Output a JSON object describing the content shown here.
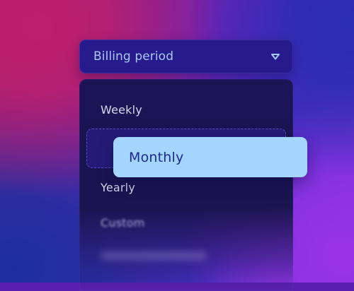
{
  "select": {
    "label": "Billing period",
    "icon": "chevron-down-icon"
  },
  "menu": {
    "items": [
      {
        "label": "Weekly"
      },
      {
        "label": "Monthly"
      },
      {
        "label": "Yearly"
      },
      {
        "label": "Custom"
      }
    ]
  },
  "dragging": {
    "label": "Monthly"
  },
  "colors": {
    "select_bg": "#261a8c",
    "menu_bg": "#1c1455",
    "drag_card_bg": "#a4d5ff",
    "drag_text": "#1e2a8e",
    "select_text": "#a9c8ff"
  }
}
